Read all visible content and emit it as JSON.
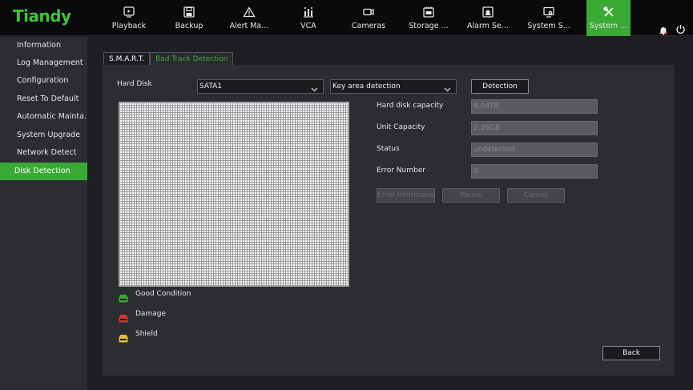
{
  "brand": {
    "logo": "Tiandy",
    "accent": "#3aaa35"
  },
  "nav": [
    {
      "label": "Playback",
      "icon": "playback-icon"
    },
    {
      "label": "Backup",
      "icon": "backup-icon"
    },
    {
      "label": "Alert Ma...",
      "icon": "alert-icon"
    },
    {
      "label": "VCA",
      "icon": "vca-icon"
    },
    {
      "label": "Cameras",
      "icon": "camera-icon"
    },
    {
      "label": "Storage ...",
      "icon": "storage-icon"
    },
    {
      "label": "Alarm Se...",
      "icon": "alarm-icon"
    },
    {
      "label": "System S...",
      "icon": "system-settings-icon"
    },
    {
      "label": "System ...",
      "icon": "tools-icon"
    }
  ],
  "sidebar": [
    {
      "label": "Information"
    },
    {
      "label": "Log Management"
    },
    {
      "label": "Configuration"
    },
    {
      "label": "Reset To Default"
    },
    {
      "label": "Automatic Mainta..."
    },
    {
      "label": "System Upgrade"
    },
    {
      "label": "Network Detect"
    },
    {
      "label": "Disk Detection"
    }
  ],
  "tabs": [
    {
      "label": "S.M.A.R.T."
    },
    {
      "label": "Bad Track Detection"
    }
  ],
  "form": {
    "hard_disk_label": "Hard Disk",
    "disk_select": "SATA1",
    "mode_select": "Key area detection",
    "detection_button": "Detection",
    "capacity_label": "Hard disk capacity",
    "capacity_value": "9.04TB",
    "unit_label": "Unit Capacity",
    "unit_value": "2.26GB",
    "status_label": "Status",
    "status_value": "undetected",
    "error_label": "Error Number",
    "error_value": "0",
    "error_info_button": "Error Information",
    "pause_button": "Pause",
    "cancel_button": "Cancel"
  },
  "legend": [
    {
      "label": "Good Condition",
      "color": "#3aaa35"
    },
    {
      "label": "Damage",
      "color": "#d03a2e"
    },
    {
      "label": "Shield",
      "color": "#e3c234"
    }
  ],
  "back_button": "Back"
}
